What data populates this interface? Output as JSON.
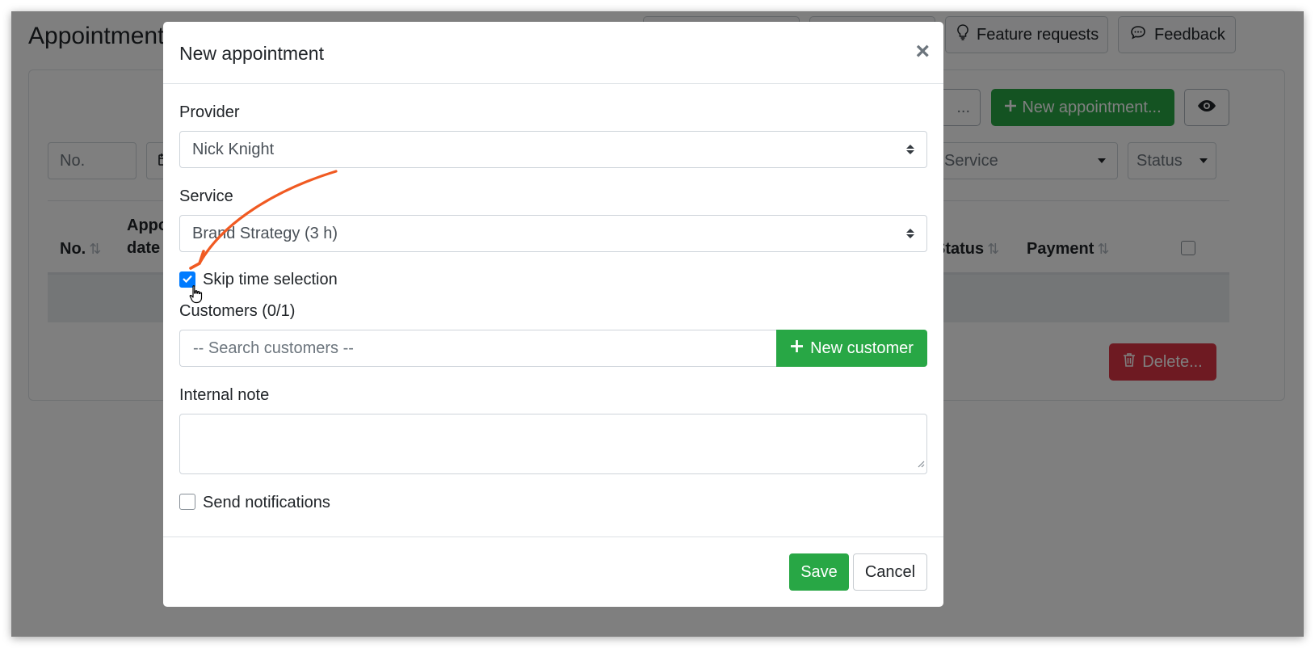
{
  "page": {
    "title": "Appointments",
    "top_buttons": [
      "Feature requests",
      "Feedback"
    ],
    "new_appointment_label": "New appointment...",
    "partial_button_label": "...",
    "filters": {
      "number_placeholder": "No.",
      "service_placeholder": "Service",
      "status_placeholder": "Status"
    },
    "table_headers": {
      "number": "No.",
      "appointment_date_1": "Appo",
      "appointment_date_2": "date",
      "status": "Status",
      "payment": "Payment"
    },
    "delete_label": "Delete..."
  },
  "modal": {
    "title": "New appointment",
    "close_label": "×",
    "provider_label": "Provider",
    "provider_value": "Nick Knight",
    "service_label": "Service",
    "service_value": "Brand Strategy (3 h)",
    "skip_time_label": "Skip time selection",
    "skip_time_checked": true,
    "customers_label": "Customers (0/1)",
    "search_placeholder": "-- Search customers --",
    "new_customer_label": "New customer",
    "internal_note_label": "Internal note",
    "send_notifications_label": "Send notifications",
    "send_notifications_checked": false,
    "save_label": "Save",
    "cancel_label": "Cancel"
  },
  "colors": {
    "green": "#28a745",
    "blue": "#007bff",
    "red": "#dc3545",
    "arrow": "#f05a22"
  },
  "icons": [
    "lightbulb-icon",
    "comment-icon",
    "plus-icon",
    "eye-icon",
    "sort-icon",
    "trash-icon",
    "check-icon",
    "close-icon",
    "hand-cursor-icon",
    "calendar-icon"
  ]
}
